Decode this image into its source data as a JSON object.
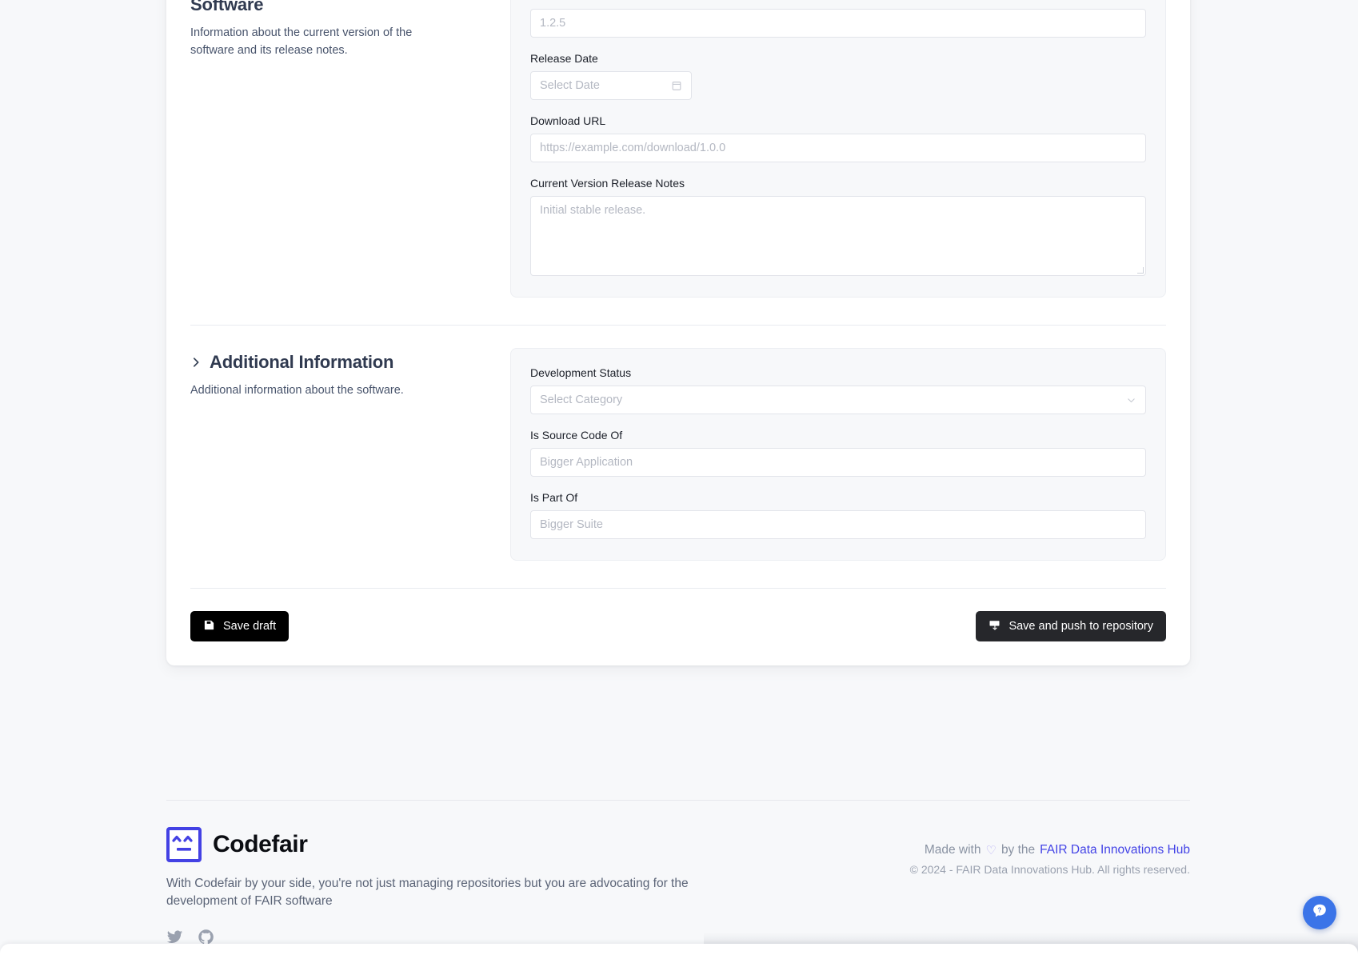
{
  "sections": [
    {
      "id": "software",
      "title": "Software",
      "description": "Information about the current version of the software and its release notes.",
      "fields": [
        {
          "label": "",
          "name": "current-version",
          "placeholder": "1.2.5",
          "type": "text"
        },
        {
          "label": "Release Date",
          "name": "release-date",
          "placeholder": "Select Date",
          "type": "date",
          "icon": "calendar-icon"
        },
        {
          "label": "Download URL",
          "name": "download-url",
          "placeholder": "https://example.com/download/1.0.0",
          "type": "text"
        },
        {
          "label": "Current Version Release Notes",
          "name": "release-notes",
          "placeholder": "Initial stable release.",
          "type": "textarea"
        }
      ]
    },
    {
      "id": "additional-information",
      "title": "Additional Information",
      "description": "Additional information about the software.",
      "fields": [
        {
          "label": "Development Status",
          "name": "development-status",
          "placeholder": "Select Category",
          "type": "select",
          "icon": "chevron-down-icon"
        },
        {
          "label": "Is Source Code Of",
          "name": "is-source-code-of",
          "placeholder": "Bigger Application",
          "type": "text"
        },
        {
          "label": "Is Part Of",
          "name": "is-part-of",
          "placeholder": "Bigger Suite",
          "type": "text"
        }
      ]
    }
  ],
  "actions": {
    "save_draft_label": "Save draft",
    "save_draft_icon": "floppy-disk-icon",
    "push_label": "Save and push to repository",
    "push_icon": "upload-icon"
  },
  "footer": {
    "brand_name": "Codefair",
    "brand_icon": "codefair-logo-icon",
    "tagline": "With Codefair by your side, you're not just managing repositories but you are advocating for the development of FAIR software",
    "socials": [
      {
        "name": "twitter-icon",
        "label": "Twitter"
      },
      {
        "name": "github-icon",
        "label": "GitHub"
      }
    ],
    "made_with_prefix": "Made with",
    "made_with_heart": "♡",
    "made_with_middle": "by the",
    "made_with_link": "FAIR Data Innovations Hub",
    "copyright": "© 2024 - FAIR Data Innovations Hub. All rights reserved."
  },
  "help": {
    "icon": "help-chat-icon",
    "label": "?"
  },
  "colors": {
    "brand_blue": "#4341e4",
    "link_blue": "#4343e6",
    "fab_blue": "#3b74e8",
    "heading": "#303a50",
    "page_bg": "#f7f8fa"
  }
}
